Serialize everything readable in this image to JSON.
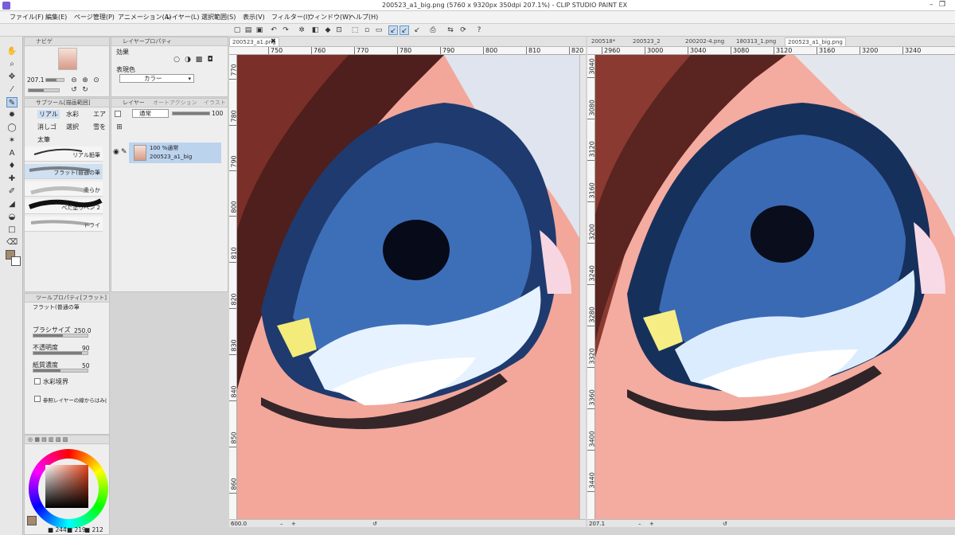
{
  "window": {
    "title": "200523_a1_big.png (5760 x 9320px 350dpi 207.1%) - CLIP STUDIO PAINT EX"
  },
  "menu": [
    "ファイル(F)",
    "編集(E)",
    "ページ管理(P)",
    "アニメーション(A)",
    "レイヤー(L)",
    "選択範囲(S)",
    "表示(V)",
    "フィルター(I)",
    "ウィンドウ(W)",
    "ヘルプ(H)"
  ],
  "navigator": {
    "zoom": "207.1"
  },
  "layer_property": {
    "title": "レイヤープロパティ",
    "effect_label": "効果",
    "expression_label": "表現色",
    "expression_value": "カラー"
  },
  "subtool": {
    "title": "サブツール[描画範囲]",
    "tabs": [
      "リアル",
      "水彩",
      "エア",
      "消しゴ",
      "選択",
      "雪を",
      "太筆"
    ],
    "brushes": [
      "リアル鉛筆",
      "フラット(普通の筆",
      "柔らか",
      "べた塗りペン 2",
      "ドライ"
    ]
  },
  "layers": {
    "tabs": [
      "レイヤー",
      "オートアクション",
      "イラスト"
    ],
    "blend_mode": "通常",
    "opacity": "100",
    "items": [
      {
        "mode": "100 %通常",
        "name": "200523_a1_big"
      }
    ]
  },
  "tool_property": {
    "title": "ツールプロパティ[フラット]",
    "brush_name": "フラット(普通の筆",
    "brush_size_label": "ブラシサイズ",
    "brush_size": "250.0",
    "opacity_label": "不透明度",
    "opacity": "90",
    "paper_label": "紙質濃度",
    "paper": "50",
    "watercolor_label": "水彩境界",
    "ref_label": "参照レイヤーの線からはみ出さない"
  },
  "color": {
    "r": "244",
    "g": "219",
    "b": "212",
    "main": "#a58a6e",
    "sub": "#ffffff"
  },
  "tabs_left": [
    "200523_a1.png"
  ],
  "tabs_right": [
    "200518*",
    "200523_2",
    "200202-4.png",
    "180313_1.png",
    "200523_a1_big.png"
  ],
  "canvas_left": {
    "h_ticks": [
      "750",
      "760",
      "770",
      "780",
      "790",
      "800",
      "810",
      "820"
    ],
    "v_ticks": [
      "770",
      "780",
      "790",
      "800",
      "810",
      "820",
      "830",
      "840",
      "850",
      "860"
    ],
    "zoom": "600.0"
  },
  "canvas_right": {
    "h_ticks": [
      "2960",
      "3000",
      "3040",
      "3080",
      "3120",
      "3160",
      "3200",
      "3240"
    ],
    "v_ticks": [
      "3040",
      "3080",
      "3120",
      "3160",
      "3200",
      "3240",
      "3280",
      "3320",
      "3360",
      "3400",
      "3440"
    ],
    "zoom": "207.1"
  }
}
